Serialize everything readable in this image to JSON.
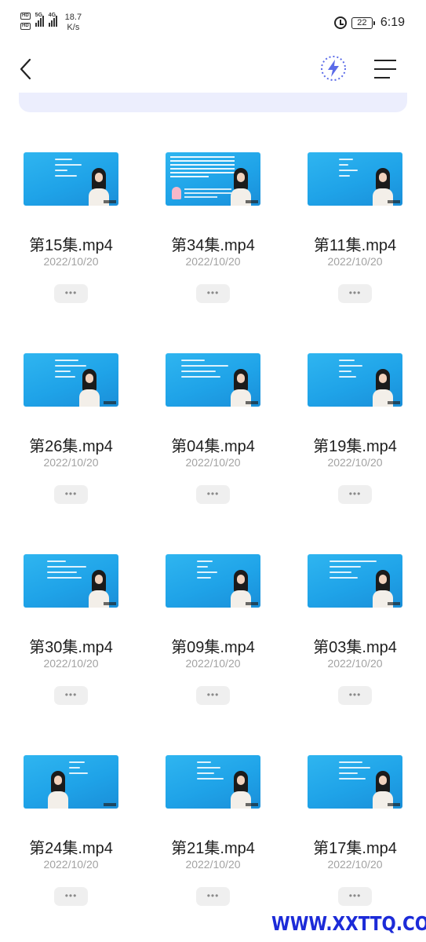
{
  "status_bar": {
    "sim1_label": "HD",
    "sim2_label": "HD",
    "net1": "5G",
    "net2": "4G",
    "speed_value": "18.7",
    "speed_unit": "K/s",
    "battery": "22",
    "time": "6:19",
    "icons": [
      "alarm-icon",
      "battery-icon"
    ]
  },
  "toolbar": {
    "back_icon": "chevron-left-icon",
    "flash_icon": "lightning-icon",
    "menu_icon": "hamburger-menu-icon",
    "accent_color": "#5b6be8"
  },
  "files": [
    {
      "name": "第15集.mp4",
      "date": "2022/10/20",
      "more": "•••"
    },
    {
      "name": "第34集.mp4",
      "date": "2022/10/20",
      "more": "•••"
    },
    {
      "name": "第11集.mp4",
      "date": "2022/10/20",
      "more": "•••"
    },
    {
      "name": "第26集.mp4",
      "date": "2022/10/20",
      "more": "•••"
    },
    {
      "name": "第04集.mp4",
      "date": "2022/10/20",
      "more": "•••"
    },
    {
      "name": "第19集.mp4",
      "date": "2022/10/20",
      "more": "•••"
    },
    {
      "name": "第30集.mp4",
      "date": "2022/10/20",
      "more": "•••"
    },
    {
      "name": "第09集.mp4",
      "date": "2022/10/20",
      "more": "•••"
    },
    {
      "name": "第03集.mp4",
      "date": "2022/10/20",
      "more": "•••"
    },
    {
      "name": "第24集.mp4",
      "date": "2022/10/20",
      "more": "•••"
    },
    {
      "name": "第21集.mp4",
      "date": "2022/10/20",
      "more": "•••"
    },
    {
      "name": "第17集.mp4",
      "date": "2022/10/20",
      "more": "•••"
    }
  ],
  "watermark_text": "WWW.XXTTQ.COM"
}
